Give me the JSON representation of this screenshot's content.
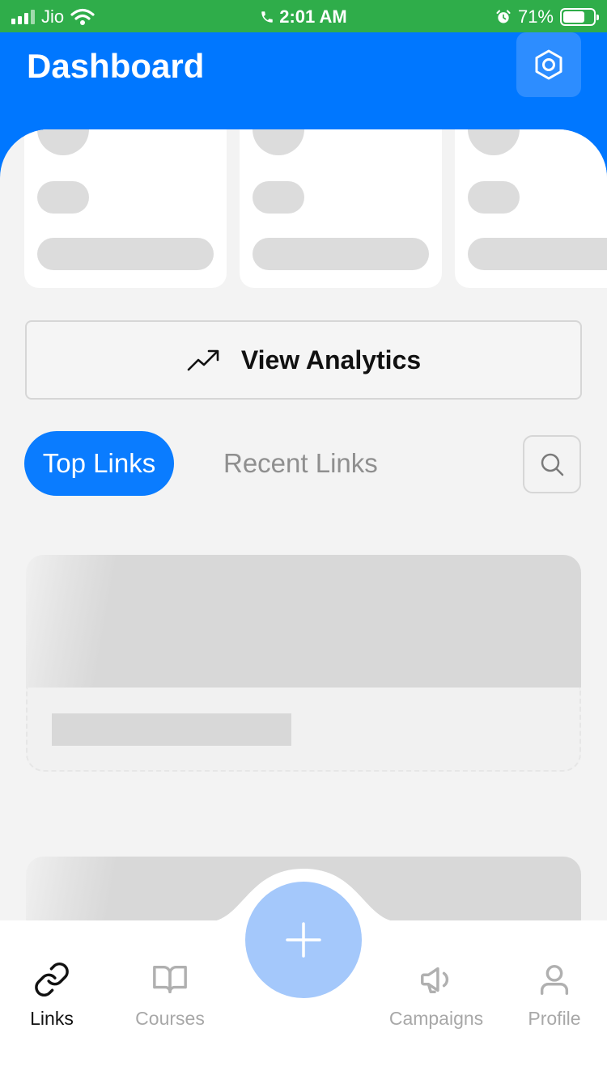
{
  "status": {
    "carrier": "Jio",
    "time": "2:01 AM",
    "battery": "71%",
    "battery_level": 0.71
  },
  "header": {
    "title": "Dashboard",
    "settings_icon": "settings-hexagon-icon"
  },
  "analytics": {
    "label": "View Analytics",
    "icon": "trending-up-icon"
  },
  "tabs": {
    "top": "Top Links",
    "recent": "Recent Links",
    "active": "Top Links"
  },
  "search": {
    "icon": "search-icon"
  },
  "nav": {
    "items": [
      {
        "label": "Links",
        "icon": "link-icon",
        "active": true
      },
      {
        "label": "Courses",
        "icon": "book-icon",
        "active": false
      },
      {
        "label": "Campaigns",
        "icon": "megaphone-icon",
        "active": false
      },
      {
        "label": "Profile",
        "icon": "user-icon",
        "active": false
      }
    ],
    "fab_icon": "plus-icon"
  },
  "colors": {
    "status_bar": "#2fad4a",
    "header": "#0077ff",
    "accent": "#0a7cff",
    "fab": "#a4c8fb"
  }
}
